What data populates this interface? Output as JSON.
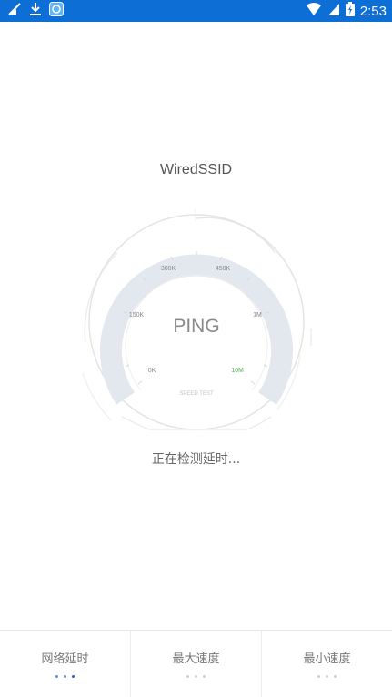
{
  "status_bar": {
    "time": "2:53",
    "icons": [
      "signal-icon",
      "download-icon",
      "app-badge-icon",
      "wifi-icon",
      "cell-signal-icon",
      "battery-icon"
    ]
  },
  "network": {
    "ssid": "WiredSSID"
  },
  "gauge": {
    "center_label": "PING",
    "footer_label": "SPEED TEST",
    "ticks": [
      "0K",
      "150K",
      "300K",
      "450K",
      "1M",
      "10M"
    ],
    "accent_color": "#4caf50",
    "track_color": "#e3e8ef"
  },
  "status": {
    "message": "正在检测延时..."
  },
  "tabs": [
    {
      "label": "网络延时",
      "active_dots": 3
    },
    {
      "label": "最大速度",
      "active_dots": 0
    },
    {
      "label": "最小速度",
      "active_dots": 0
    }
  ]
}
